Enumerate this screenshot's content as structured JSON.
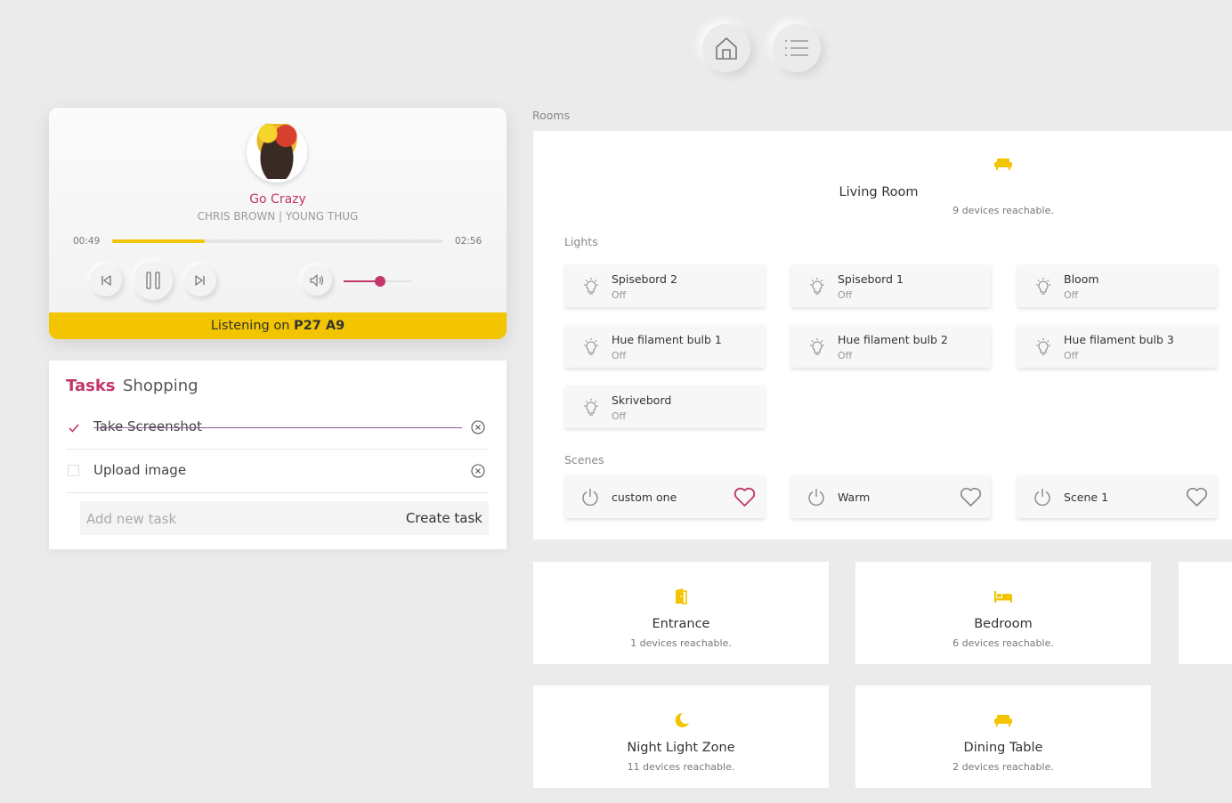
{
  "nav": {
    "home_icon": "home-icon",
    "menu_icon": "list-icon"
  },
  "player": {
    "song_title": "Go Crazy",
    "artist": "CHRIS BROWN | YOUNG THUG",
    "time_elapsed": "00:49",
    "time_total": "02:56",
    "progress": 0.28,
    "volume": 0.53,
    "listening_prefix": "Listening on",
    "device": "P27 A9",
    "colors": {
      "accent": "#c2366a",
      "bar": "#f2c500"
    }
  },
  "tasks": {
    "tab_tasks": "Tasks",
    "tab_shopping": "Shopping",
    "items": [
      {
        "label": "Take Screenshot",
        "done": true
      },
      {
        "label": "Upload image",
        "done": false
      }
    ],
    "new_task_placeholder": "Add new task",
    "create_label": "Create task"
  },
  "rooms": {
    "section_label": "Rooms",
    "featured": {
      "name": "Living Room",
      "subtitle": "9 devices reachable.",
      "lights_label": "Lights",
      "lights": [
        {
          "name": "Spisebord 2",
          "state": "Off"
        },
        {
          "name": "Spisebord 1",
          "state": "Off"
        },
        {
          "name": "Bloom",
          "state": "Off"
        },
        {
          "name": "Hue filament bulb 1",
          "state": "Off"
        },
        {
          "name": "Hue filament bulb 2",
          "state": "Off"
        },
        {
          "name": "Hue filament bulb 3",
          "state": "Off"
        },
        {
          "name": "Skrivebord",
          "state": "Off"
        }
      ],
      "scenes_label": "Scenes",
      "scenes": [
        {
          "name": "custom one",
          "favorite": true
        },
        {
          "name": "Warm",
          "favorite": false
        },
        {
          "name": "Scene 1",
          "favorite": false
        }
      ]
    },
    "cards": [
      {
        "name": "Entrance",
        "subtitle": "1 devices reachable.",
        "icon": "door-icon"
      },
      {
        "name": "Bedroom",
        "subtitle": "6 devices reachable.",
        "icon": "bed-icon"
      },
      {
        "name": "",
        "subtitle": "",
        "icon": ""
      },
      {
        "name": "Night Light Zone",
        "subtitle": "11 devices reachable.",
        "icon": "moon-icon"
      },
      {
        "name": "Dining Table",
        "subtitle": "2 devices reachable.",
        "icon": "sofa-icon"
      }
    ],
    "icon_color": "#f2c500"
  }
}
